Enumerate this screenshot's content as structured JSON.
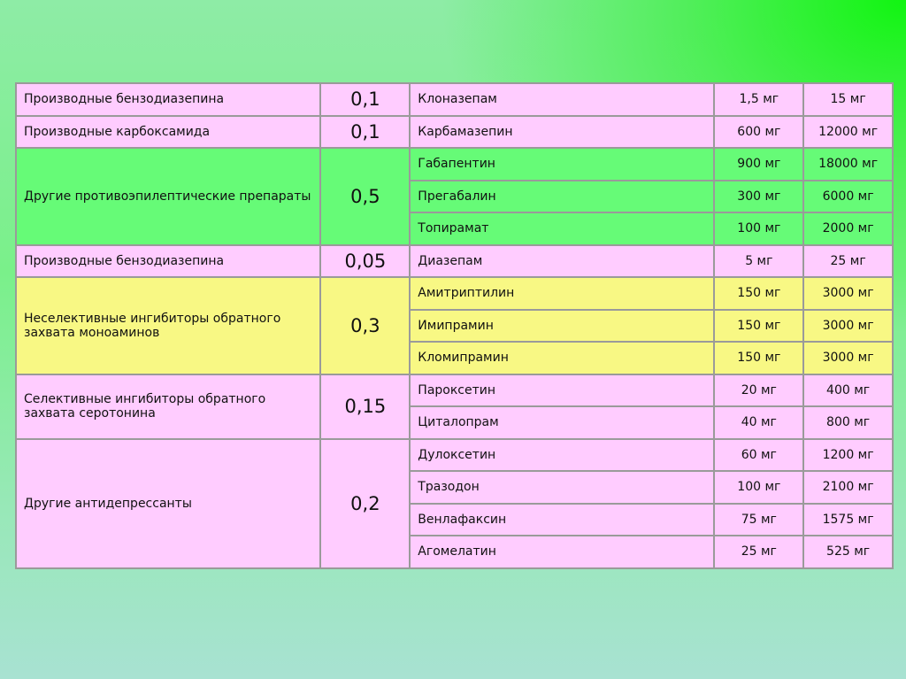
{
  "groups": [
    {
      "class": "Производные бензодиазепина",
      "coef": "0,1",
      "color": "pink",
      "drugs": [
        {
          "name": "Клоназепам",
          "dose": "1,5 мг",
          "max": "15 мг"
        }
      ]
    },
    {
      "class": "Производные карбоксамида",
      "coef": "0,1",
      "color": "pink",
      "drugs": [
        {
          "name": "Карбамазепин",
          "dose": "600 мг",
          "max": "12000 мг"
        }
      ]
    },
    {
      "class": "Другие противоэпилептические препараты",
      "coef": "0,5",
      "color": "green",
      "drugs": [
        {
          "name": "Габапентин",
          "dose": "900 мг",
          "max": "18000 мг"
        },
        {
          "name": "Прегабалин",
          "dose": "300 мг",
          "max": "6000 мг"
        },
        {
          "name": "Топирамат",
          "dose": "100 мг",
          "max": "2000 мг"
        }
      ]
    },
    {
      "class": "Производные бензодиазепина",
      "coef": "0,05",
      "color": "pink",
      "drugs": [
        {
          "name": "Диазепам",
          "dose": "5 мг",
          "max": "25 мг"
        }
      ]
    },
    {
      "class": "Неселективные ингибиторы обратного захвата моноаминов",
      "coef": "0,3",
      "color": "yellow",
      "drugs": [
        {
          "name": "Амитриптилин",
          "dose": "150 мг",
          "max": "3000 мг"
        },
        {
          "name": "Имипрамин",
          "dose": "150 мг",
          "max": "3000 мг"
        },
        {
          "name": "Кломипрамин",
          "dose": "150 мг",
          "max": "3000 мг"
        }
      ]
    },
    {
      "class": "Селективные ингибиторы обратного захвата серотонина",
      "coef": "0,15",
      "color": "pink",
      "drugs": [
        {
          "name": "Пароксетин",
          "dose": "20 мг",
          "max": "400 мг"
        },
        {
          "name": "Циталопрам",
          "dose": "40 мг",
          "max": "800 мг"
        }
      ]
    },
    {
      "class": "Другие антидепрессанты",
      "coef": "0,2",
      "color": "pink",
      "drugs": [
        {
          "name": "Дулоксетин",
          "dose": "60 мг",
          "max": "1200 мг"
        },
        {
          "name": "Тразодон",
          "dose": "100 мг",
          "max": "2100 мг"
        },
        {
          "name": "Венлафаксин",
          "dose": "75 мг",
          "max": "1575 мг"
        },
        {
          "name": "Агомелатин",
          "dose": "25 мг",
          "max": "525 мг"
        }
      ]
    }
  ]
}
